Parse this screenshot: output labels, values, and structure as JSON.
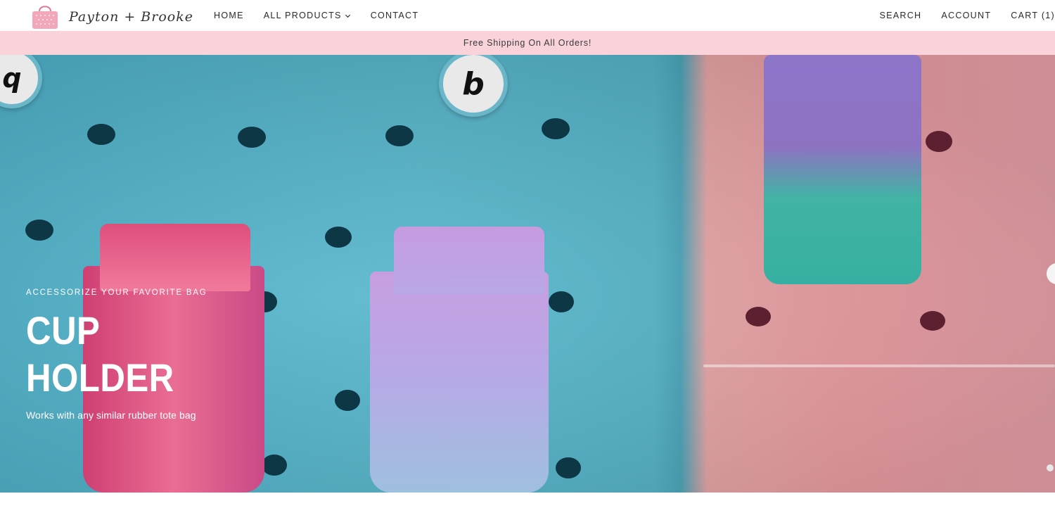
{
  "brand": {
    "logo_name": "Payton + Brooke",
    "logo_icon": "tote-bag-icon"
  },
  "nav": {
    "items": [
      {
        "label": "HOME"
      },
      {
        "label": "ALL PRODUCTS",
        "icon": "chevron-down-icon"
      },
      {
        "label": "CONTACT"
      }
    ]
  },
  "utility": {
    "search": "SEARCH",
    "account": "ACCOUNT",
    "cart": "CART (1)"
  },
  "announcement": "Free Shipping On All Orders!",
  "hero": {
    "eyebrow": "ACCESSORIZE YOUR FAVORITE BAG",
    "title_line1": "CUP",
    "title_line2": "HOLDER",
    "subtitle": "Works with any similar rubber tote bag",
    "badge_left": "q",
    "badge_right": "b"
  },
  "colors": {
    "announcement_bg": "#f9d2da",
    "tote_blue": "#56b4c9",
    "tote_pink": "#ee9fa5"
  }
}
